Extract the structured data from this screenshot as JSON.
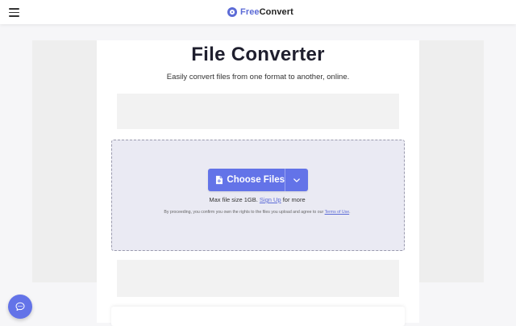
{
  "header": {
    "menu_icon": "hamburger-menu-icon",
    "logo": {
      "icon": "freeconvert-logo-icon",
      "text_part1": "Free",
      "text_part2": "Convert",
      "brand_color": "#5c6bd6"
    }
  },
  "main": {
    "title": "File Converter",
    "subtitle": "Easily convert files from one format to another, online."
  },
  "upload": {
    "choose_files_label": "Choose Files",
    "file_icon": "file-plus-icon",
    "dropdown_icon": "chevron-down-icon",
    "max_size_prefix": "Max file size 1GB.",
    "sign_up_label": "Sign Up",
    "max_size_suffix": "for more",
    "legal_prefix": "By proceeding, you confirm you own the rights to the files you upload and agree to our",
    "terms_label": "Terms of Use",
    "legal_suffix": ".",
    "button_color": "#6373e8"
  },
  "chat": {
    "icon": "chat-bubble-icon"
  }
}
